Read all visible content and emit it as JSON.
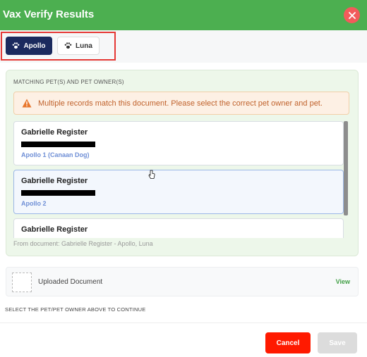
{
  "header": {
    "title": "Vax Verify Results"
  },
  "tabs": [
    {
      "label": "Apollo",
      "active": true
    },
    {
      "label": "Luna",
      "active": false
    }
  ],
  "match": {
    "section_label": "MATCHING PET(S) AND PET OWNER(S)",
    "warning": "Multiple records match this document. Please select the correct pet owner and pet.",
    "records": [
      {
        "owner": "Gabrielle Register",
        "pet": "Apollo 1 (Canaan Dog)"
      },
      {
        "owner": "Gabrielle Register",
        "pet": "Apollo 2"
      },
      {
        "owner": "Gabrielle Register",
        "pet": ""
      }
    ],
    "from_document": "From document: Gabrielle Register - Apollo, Luna"
  },
  "document": {
    "label": "Uploaded Document",
    "view_label": "View"
  },
  "continue_note": "SELECT THE PET/PET OWNER ABOVE TO CONTINUE",
  "footer": {
    "cancel_label": "Cancel",
    "save_label": "Save"
  },
  "colors": {
    "header": "#4caf50",
    "cancel": "#ff1a00",
    "active_tab": "#1b2a5e",
    "highlight": "#e53935"
  },
  "icons": [
    "close-icon",
    "paw-icon",
    "warning-icon",
    "document-thumbnail",
    "pointer-cursor"
  ]
}
